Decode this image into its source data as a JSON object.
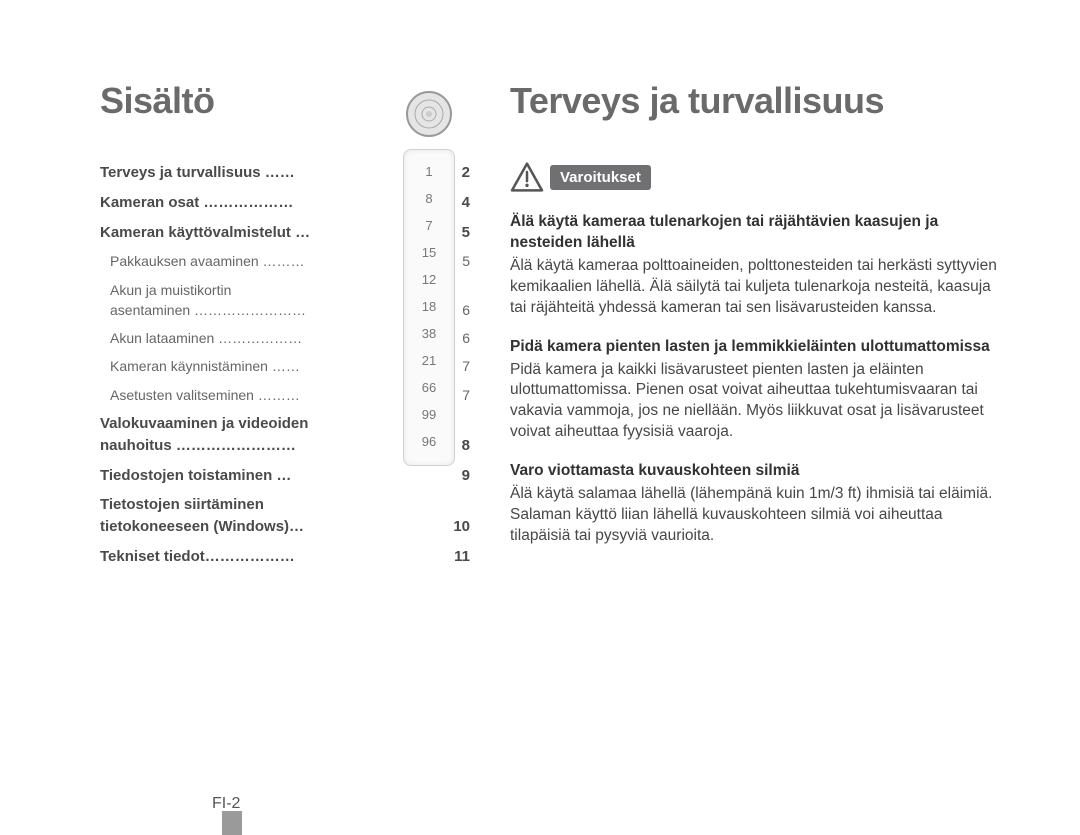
{
  "left_heading": "Sisältö",
  "right_heading": "Terveys ja turvallisuus",
  "toc": {
    "r0_label": "Terveys ja turvallisuus  ……",
    "r0_page": "2",
    "r1_label": "Kameran osat  ………………",
    "r1_page": "4",
    "r2_label": "Kameran käyttövalmistelut …",
    "r2_page": "5",
    "r2a_label": "Pakkauksen avaaminen  ………",
    "r2a_page": "5",
    "r2b_label": "Akun ja muistikortin",
    "r2b2_label": "asentaminen  ……………………",
    "r2b_page": "6",
    "r2c_label": "Akun lataaminen  ………………",
    "r2c_page": "6",
    "r2d_label": "Kameran käynnistäminen  ……",
    "r2d_page": "7",
    "r2e_label": "Asetusten valitseminen  ………",
    "r2e_page": "7",
    "r3_label": "Valokuvaaminen ja videoiden",
    "r3b_label": "nauhoitus  ……………………",
    "r3_page": "8",
    "r4_label": "Tiedostojen toistaminen  …",
    "r4_page": "9",
    "r5_label": "Tietostojen siirtäminen",
    "r5b_label": "tietokoneeseen (Windows)…",
    "r5_page": "10",
    "r6_label": "Tekniset tiedot………………",
    "r6_page": "11"
  },
  "gauge": {
    "v0": "1",
    "v1": "8",
    "v2": "7",
    "v3": "15",
    "v4": "12",
    "v5": "18",
    "v6": "38",
    "v7": "21",
    "v8": "66",
    "v9": "99",
    "v10": "96"
  },
  "warn_label": "Varoitukset",
  "safety": {
    "t0": "Älä käytä kameraa tulenarkojen tai räjähtävien kaasujen ja nesteiden lähellä",
    "b0": "Älä käytä kameraa polttoaineiden, polttonesteiden tai herkästi syttyvien kemikaalien lähellä. Älä säilytä tai kuljeta tulenarkoja nesteitä, kaasuja tai räjähteitä yhdessä kameran tai sen lisävarusteiden kanssa.",
    "t1": "Pidä kamera pienten lasten ja lemmikkieläinten ulottumattomissa",
    "b1": "Pidä kamera ja kaikki lisävarusteet pienten lasten ja eläinten ulottumattomissa. Pienen osat voivat aiheuttaa tukehtumisvaaran tai vakavia vammoja, jos ne niellään. Myös liikkuvat osat ja lisävarusteet voivat aiheuttaa fyysisiä vaaroja.",
    "t2": "Varo viottamasta kuvauskohteen silmiä",
    "b2": "Älä käytä salamaa lähellä (lähempänä kuin 1m/3 ft) ihmisiä tai eläimiä. Salaman käyttö liian lähellä kuvauskohteen silmiä voi aiheuttaa tilapäisiä tai pysyviä vaurioita."
  },
  "page_number": "FI-2"
}
